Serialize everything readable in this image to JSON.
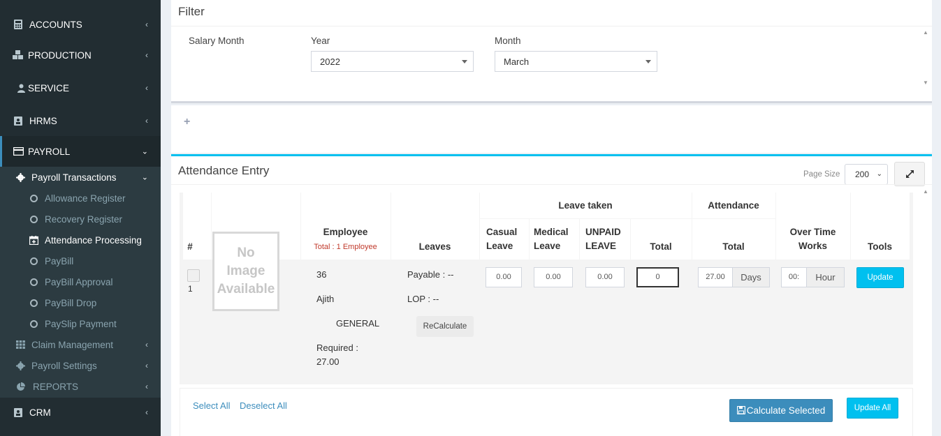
{
  "sidebar": {
    "accounts": "ACCOUNTS",
    "production": "PRODUCTION",
    "service": "SERVICE",
    "hrms": "HRMS",
    "payroll": "PAYROLL",
    "payroll_transactions": "Payroll Transactions",
    "allowance_register": "Allowance Register",
    "recovery_register": "Recovery Register",
    "attendance_processing": "Attendance Processing",
    "paybill": "PayBill",
    "paybill_approval": "PayBill Approval",
    "paybill_drop": "PayBill Drop",
    "payslip_payment": "PaySlip Payment",
    "claim_management": "Claim Management",
    "payroll_settings": "Payroll Settings",
    "reports": "REPORTS",
    "crm": "CRM"
  },
  "filter": {
    "title": "Filter",
    "salary_month_label": "Salary Month",
    "year_label": "Year",
    "year_value": "2022",
    "month_label": "Month",
    "month_value": "March"
  },
  "attendance": {
    "title": "Attendance Entry",
    "page_size_label": "Page Size",
    "page_size_value": "200",
    "headers": {
      "num": "#",
      "employee": "Employee",
      "employee_total": "Total : 1 Employee",
      "leaves": "Leaves",
      "leave_taken": "Leave taken",
      "casual_leave_1": "Casual",
      "casual_leave_2": "Leave",
      "medical_leave_1": "Medical",
      "medical_leave_2": "Leave",
      "unpaid_leave_1": "UNPAID",
      "unpaid_leave_2": "LEAVE",
      "leave_total": "Total",
      "attendance": "Attendance",
      "attendance_total": "Total",
      "overtime_1": "Over Time",
      "overtime_2": "Works",
      "tools": "Tools"
    },
    "row": {
      "index": "1",
      "no_image_1": "No",
      "no_image_2": "Image",
      "no_image_3": "Available",
      "emp_code": "36",
      "emp_name": "Ajith",
      "emp_dept": "GENERAL",
      "required_label": "Required :",
      "required_value": "27.00",
      "payable": "Payable : --",
      "lop": "LOP : --",
      "recalculate": "ReCalculate",
      "casual": "0.00",
      "medical": "0.00",
      "unpaid": "0.00",
      "leave_total": "0",
      "attendance_total": "27.00",
      "days": "Days",
      "overtime": "00:",
      "hour": "Hour",
      "update": "Update"
    },
    "footer": {
      "select_all": "Select All",
      "deselect_all": "Deselect All",
      "calculate_selected": "Calculate Selected",
      "update_all": "Update All"
    }
  }
}
